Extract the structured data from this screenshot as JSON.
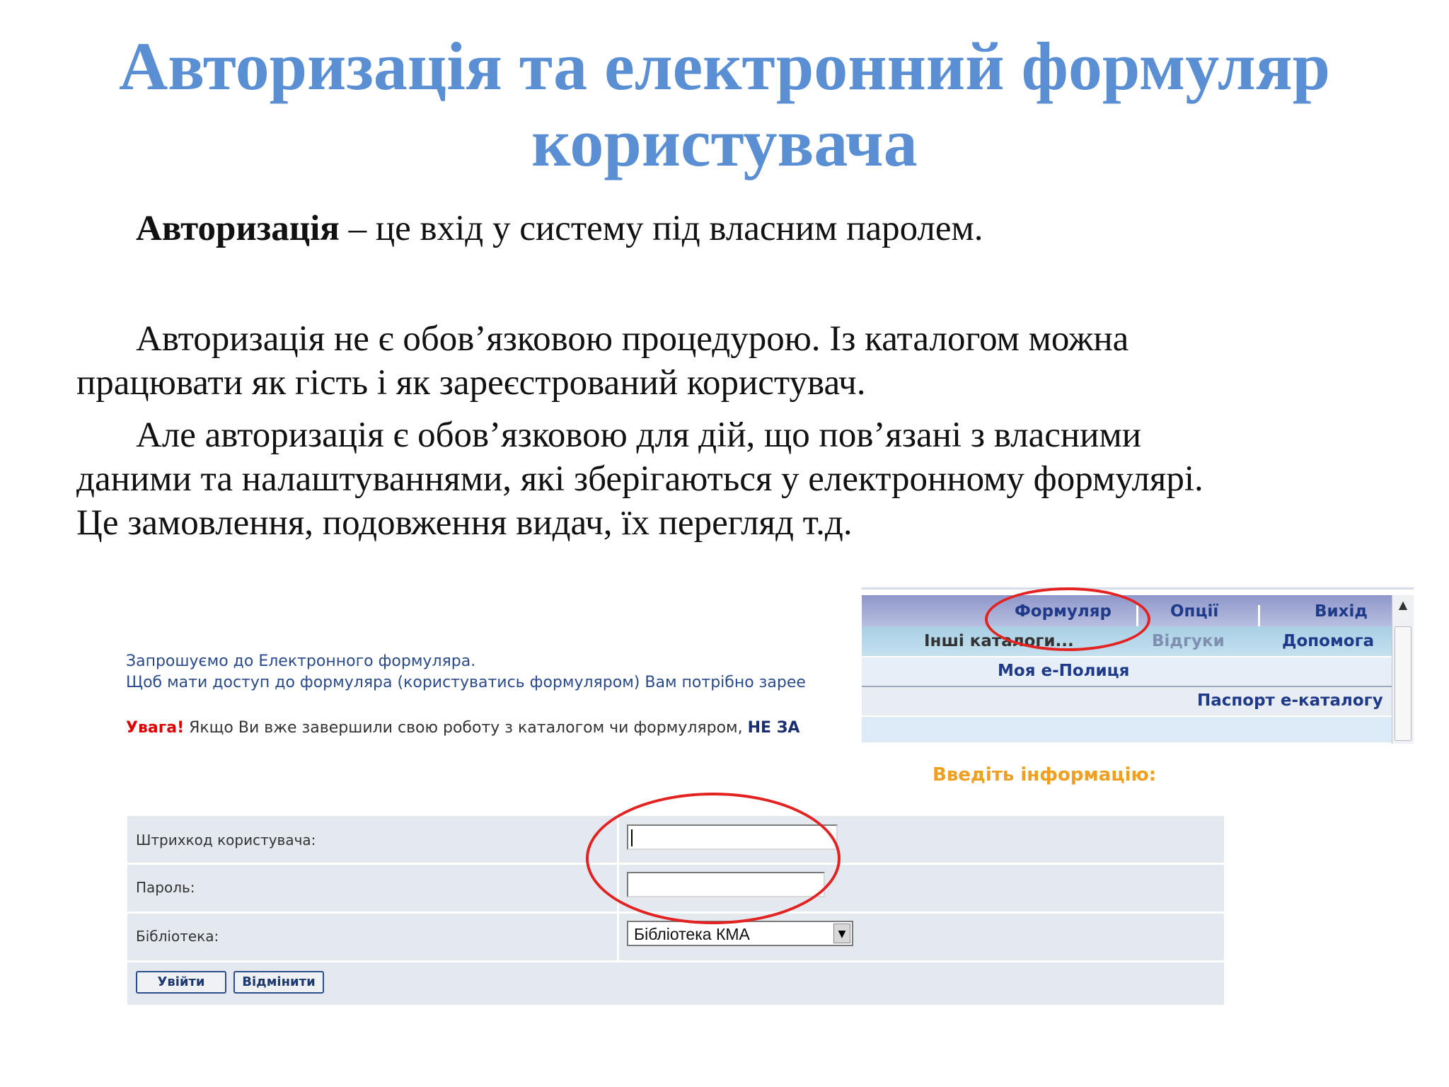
{
  "slide": {
    "title_line1": "Авторизація та електронний формуляр",
    "title_line2": "користувача",
    "p1_bold": "Авторизація",
    "p1_rest": " – це вхід у систему під власним паролем.",
    "p2_line1": "Авторизація не є обов’язковою процедурою. Із каталогом можна",
    "p2_line2": "працювати як гість і як зареєстрований користувач.",
    "p3_line1": "Але авторизація є обов’язковою для дій, що пов’язані з власними",
    "p3_line2": "даними та налаштуваннями, які зберігаються у електронному формулярі.",
    "p3_line3": "Це замовлення, подовження видач, їх перегляд т.д."
  },
  "screenshot": {
    "intro_line1": "Запрошуємо до Електронного формуляра.",
    "intro_line2": "Щоб мати доступ до формуляра (користуватись формуляром) Вам потрібно зарее",
    "warning_label": "Увага!",
    "warning_text": " Якщо Ви вже завершили свою роботу з каталогом чи формуляром, ",
    "warning_bold": "НЕ ЗА",
    "enter_info": "Введіть інформацію:",
    "menu": {
      "formular": "Формуляр",
      "options": "Опції",
      "exit": "Вихід",
      "other_catalogs": "Інші каталоги...",
      "feedback": "Відгуки",
      "help": "Допомога",
      "my_shelf": "Моя е-Полиця",
      "passport": "Паспорт е-каталогу"
    },
    "form": {
      "barcode_label": "Штрихкод користувача:",
      "password_label": "Пароль:",
      "library_label": "Бібліотека:",
      "library_value": "Бібліотека КМА",
      "login_button": "Увійти",
      "cancel_button": "Відмінити"
    },
    "highlight_color": "#e32222"
  }
}
